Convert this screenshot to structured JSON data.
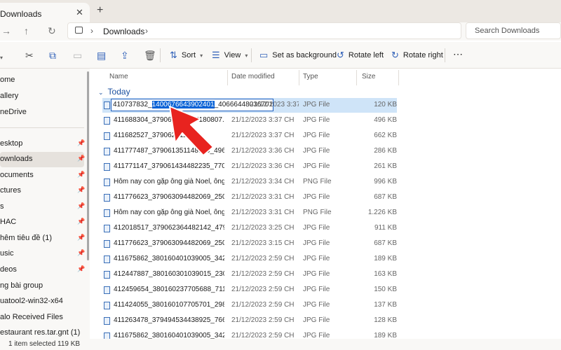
{
  "tab": {
    "title": "Downloads",
    "close": "✕",
    "new": "+"
  },
  "nav": {
    "back": "←",
    "forward": "→",
    "up": "↑",
    "refresh": "↻",
    "sep": "›"
  },
  "address": {
    "crumb": "Downloads"
  },
  "search": {
    "placeholder": "Search Downloads"
  },
  "toolbar": {
    "sort": "Sort",
    "view": "View",
    "set_background": "Set as background",
    "rotate_left": "Rotate left",
    "rotate_right": "Rotate right",
    "more": "⋯"
  },
  "sidebar": {
    "items": [
      {
        "label": "ome",
        "pinned": false
      },
      {
        "label": "allery",
        "pinned": false
      },
      {
        "label": "neDrive",
        "pinned": false
      },
      {
        "label": "esktop",
        "pinned": true
      },
      {
        "label": "ownloads",
        "pinned": true
      },
      {
        "label": "ocuments",
        "pinned": true
      },
      {
        "label": "ctures",
        "pinned": true
      },
      {
        "label": "s",
        "pinned": true
      },
      {
        "label": "HAC",
        "pinned": true
      },
      {
        "label": "hêm tiêu đề (1)",
        "pinned": true
      },
      {
        "label": "usic",
        "pinned": true
      },
      {
        "label": "deos",
        "pinned": true
      },
      {
        "label": "ng bài group",
        "pinned": false
      },
      {
        "label": "uatool2-win32-x64",
        "pinned": false
      },
      {
        "label": "alo Received Files",
        "pinned": false
      },
      {
        "label": "estaurant  res.tar.gnt (1)",
        "pinned": false
      }
    ]
  },
  "columns": {
    "name": "Name",
    "date": "Date modified",
    "type": "Type",
    "size": "Size"
  },
  "group": {
    "label": "Today"
  },
  "rename": {
    "before": "410737832_",
    "selected": "1400676643902401",
    "after": "_4066644803670191_n",
    "date": "21/12/2023 3:37:04 CH",
    "type": "JPG File",
    "size": "120 KB"
  },
  "files": [
    {
      "name": "411688304_379062091877180807...",
      "date": "21/12/2023 3:37 CH",
      "type": "JPG File",
      "size": "496 KB"
    },
    {
      "name": "411682527_379062611...",
      "date": "21/12/2023 3:37 CH",
      "type": "JPG File",
      "size": "662 KB"
    },
    {
      "name": "411777487_379061351148910_496...",
      "date": "21/12/2023 3:36 CH",
      "type": "JPG File",
      "size": "286 KB"
    },
    {
      "name": "411771147_379061434482235_7700613969...",
      "date": "21/12/2023 3:36 CH",
      "type": "JPG File",
      "size": "261 KB"
    },
    {
      "name": "Hôm nay con gặp ông già Noel, ông vui ...",
      "date": "21/12/2023 3:34 CH",
      "type": "PNG File",
      "size": "996 KB"
    },
    {
      "name": "411776623_379063094482069_2503163102...",
      "date": "21/12/2023 3:31 CH",
      "type": "JPG File",
      "size": "687 KB"
    },
    {
      "name": "Hôm nay con gặp ông già Noel, ông vui ...",
      "date": "21/12/2023 3:31 CH",
      "type": "PNG File",
      "size": "1.226 KB"
    },
    {
      "name": "412018517_379062364482142_4799702774...",
      "date": "21/12/2023 3:25 CH",
      "type": "JPG File",
      "size": "911 KB"
    },
    {
      "name": "411776623_379063094482069_2503163102...",
      "date": "21/12/2023 3:15 CH",
      "type": "JPG File",
      "size": "687 KB"
    },
    {
      "name": "411675862_380160401039005_3427690810...",
      "date": "21/12/2023 2:59 CH",
      "type": "JPG File",
      "size": "189 KB"
    },
    {
      "name": "412447887_380160301039015_2305590616...",
      "date": "21/12/2023 2:59 CH",
      "type": "JPG File",
      "size": "163 KB"
    },
    {
      "name": "412459654_380160237705688_7113576349...",
      "date": "21/12/2023 2:59 CH",
      "type": "JPG File",
      "size": "150 KB"
    },
    {
      "name": "411424055_380160107705701_2984757205...",
      "date": "21/12/2023 2:59 CH",
      "type": "JPG File",
      "size": "137 KB"
    },
    {
      "name": "411263478_379494534438925_7668276890...",
      "date": "21/12/2023 2:59 CH",
      "type": "JPG File",
      "size": "128 KB"
    },
    {
      "name": "411675862_380160401039005_3427690810...",
      "date": "21/12/2023 2:59 CH",
      "type": "JPG File",
      "size": "189 KB"
    }
  ],
  "status": {
    "text": "1 item selected  119 KB"
  },
  "colors": {
    "accent": "#0a63d6",
    "arrow": "#e8231f",
    "selection": "#cfe4f8"
  }
}
